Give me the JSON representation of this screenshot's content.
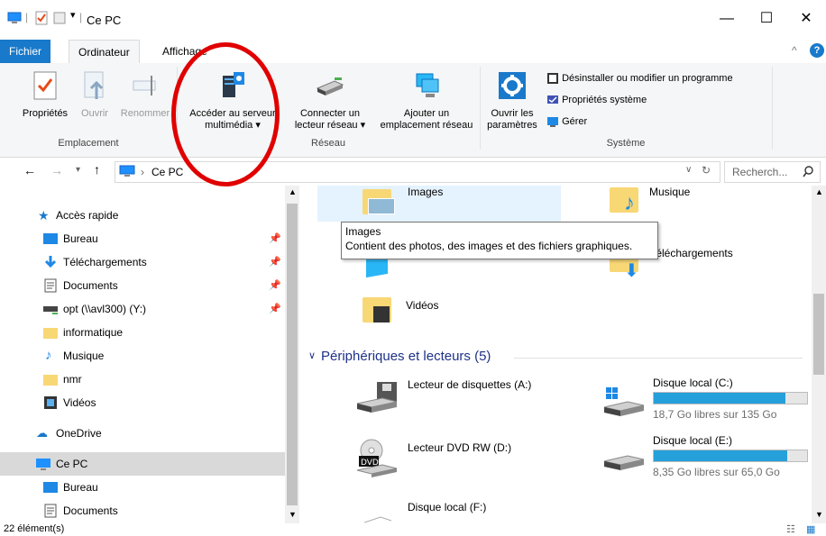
{
  "window": {
    "title": "Ce PC"
  },
  "tabs": [
    {
      "label": "Fichier"
    },
    {
      "label": "Ordinateur"
    },
    {
      "label": "Affichage"
    }
  ],
  "ribbon": {
    "groups": [
      {
        "label": "Emplacement"
      },
      {
        "label": "Réseau"
      },
      {
        "label": "Système"
      }
    ],
    "buttons": {
      "proprietes": "Propriétés",
      "ouvrir": "Ouvrir",
      "renommer": "Renommer",
      "acceder_l1": "Accéder au serveur",
      "acceder_l2": "multimédia ▾",
      "connecter_l1": "Connecter un",
      "connecter_l2": "lecteur réseau ▾",
      "ajouter_l1": "Ajouter un",
      "ajouter_l2": "emplacement réseau",
      "parametres_l1": "Ouvrir les",
      "parametres_l2": "paramètres",
      "desinstaller": "Désinstaller ou modifier un programme",
      "proprietes_systeme": "Propriétés système",
      "gerer": "Gérer"
    }
  },
  "address": {
    "path": "Ce PC",
    "search_placeholder": "Recherch..."
  },
  "nav": {
    "items": [
      {
        "label": "Accès rapide",
        "pinned": false
      },
      {
        "label": "Bureau",
        "pinned": true
      },
      {
        "label": "Téléchargements",
        "pinned": true
      },
      {
        "label": "Documents",
        "pinned": true
      },
      {
        "label": "opt (\\\\avl300) (Y:)",
        "pinned": true
      },
      {
        "label": "informatique",
        "pinned": false
      },
      {
        "label": "Musique",
        "pinned": false
      },
      {
        "label": "nmr",
        "pinned": false
      },
      {
        "label": "Vidéos",
        "pinned": false
      },
      {
        "label": "OneDrive",
        "pinned": false
      },
      {
        "label": "Ce PC",
        "pinned": false
      },
      {
        "label": "Bureau",
        "pinned": false
      },
      {
        "label": "Documents",
        "pinned": false
      }
    ]
  },
  "content": {
    "folders": [
      {
        "label": "Images"
      },
      {
        "label": "Musique"
      },
      {
        "label": "Téléchargements"
      },
      {
        "label": "Vidéos"
      }
    ],
    "devices_header": "Périphériques et lecteurs (5)",
    "drives": [
      {
        "label": "Lecteur de disquettes (A:)"
      },
      {
        "label": "Disque local (C:)",
        "free": "18,7 Go libres sur 135 Go",
        "used_fraction": 0.86
      },
      {
        "label": "Lecteur DVD RW (D:)"
      },
      {
        "label": "Disque local (E:)",
        "free": "8,35 Go libres sur 65,0 Go",
        "used_fraction": 0.87
      },
      {
        "label": "Disque local (F:)"
      }
    ]
  },
  "tooltip": {
    "title": "Images",
    "body": "Contient des photos, des images et des fichiers graphiques."
  },
  "status": {
    "count": "22 élément(s)"
  },
  "colors": {
    "accent": "#1979ca",
    "drive_fill": "#26a0da",
    "highlight": "#e5f3ff",
    "annotation": "#e00000"
  }
}
